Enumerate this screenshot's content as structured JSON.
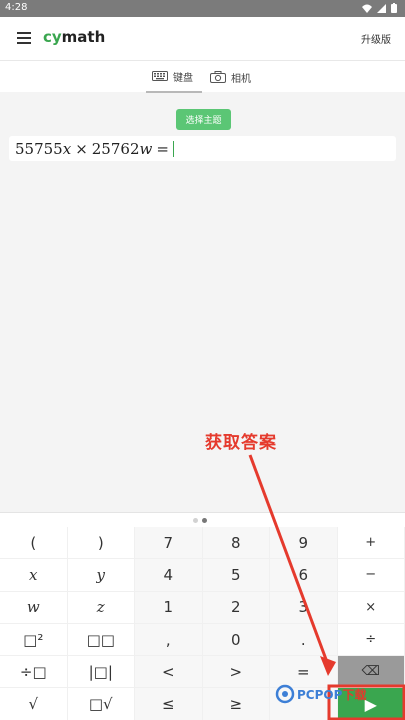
{
  "status": {
    "time": "4:28"
  },
  "app": {
    "brand_cy": "cy",
    "brand_math": "math",
    "upgrade": "升级版"
  },
  "tabs": [
    {
      "label": "键盘",
      "icon": "keyboard-icon",
      "active": true
    },
    {
      "label": "相机",
      "icon": "camera-icon",
      "active": false
    }
  ],
  "choose_topic": "选择主题",
  "expression": {
    "n1": "55755",
    "v1": "x",
    "op": "×",
    "n2": "25762",
    "v2": "w",
    "eq": "="
  },
  "annotation": "获取答案",
  "keypad": {
    "pages": 2,
    "active_page": 2,
    "keys": [
      [
        "(",
        ")",
        "7",
        "8",
        "9",
        "+"
      ],
      [
        "x",
        "y",
        "4",
        "5",
        "6",
        "−"
      ],
      [
        "w",
        "z",
        "1",
        "2",
        "3",
        "×"
      ],
      [
        "□²",
        "□□",
        ",",
        "0",
        ".",
        "÷"
      ],
      [
        "÷□",
        "|□|",
        "<",
        ">",
        "=",
        "⌫"
      ],
      [
        "√",
        "□√",
        "≤",
        "≥",
        "",
        "▶"
      ]
    ]
  },
  "watermark": {
    "main": "PCPOP",
    "suffix": "下载"
  },
  "colors": {
    "accent": "#3aa64f",
    "annotation": "#e53a2d",
    "status_bar": "#7b7b7b"
  }
}
